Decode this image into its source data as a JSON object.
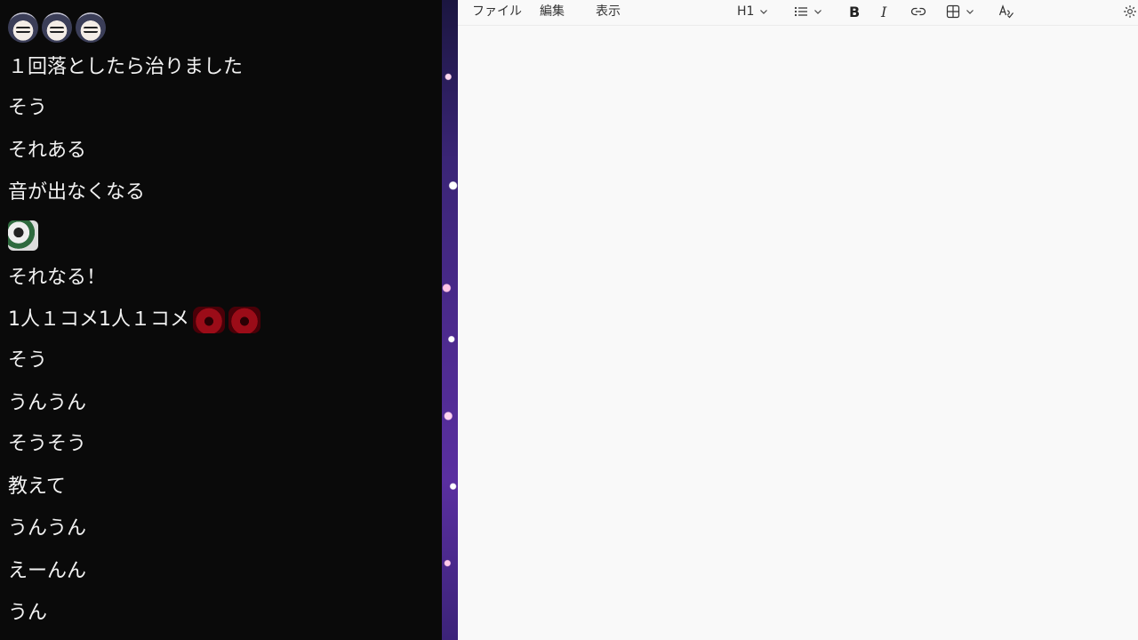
{
  "chat": {
    "messages": [
      {
        "text": "",
        "stamps": [
          "face",
          "face",
          "face"
        ]
      },
      {
        "text": "１回落としたら治りました",
        "stamps": []
      },
      {
        "text": "そう",
        "stamps": []
      },
      {
        "text": "それある",
        "stamps": []
      },
      {
        "text": "音が出なくなる",
        "stamps": []
      },
      {
        "text": "",
        "stamps": [
          "mono"
        ]
      },
      {
        "text": "それなる！",
        "stamps": []
      },
      {
        "text": "1人１コメ1人１コメ",
        "stamps": [
          "red",
          "red"
        ]
      },
      {
        "text": "そう",
        "stamps": []
      },
      {
        "text": "うんうん",
        "stamps": []
      },
      {
        "text": "そうそう",
        "stamps": []
      },
      {
        "text": "教えて",
        "stamps": []
      },
      {
        "text": "うんうん",
        "stamps": []
      },
      {
        "text": "えーんん",
        "stamps": []
      },
      {
        "text": "うん",
        "stamps": []
      }
    ]
  },
  "editor": {
    "menu": {
      "file": "ファイル",
      "edit": "編集",
      "view": "表示"
    },
    "toolbar": {
      "heading": "H1",
      "list_icon": "bullet-list-icon",
      "bold": "B",
      "italic": "I",
      "link_icon": "link-icon",
      "table_icon": "table-icon",
      "spellcheck_icon": "spellcheck-icon",
      "settings_icon": "gear-icon"
    }
  }
}
